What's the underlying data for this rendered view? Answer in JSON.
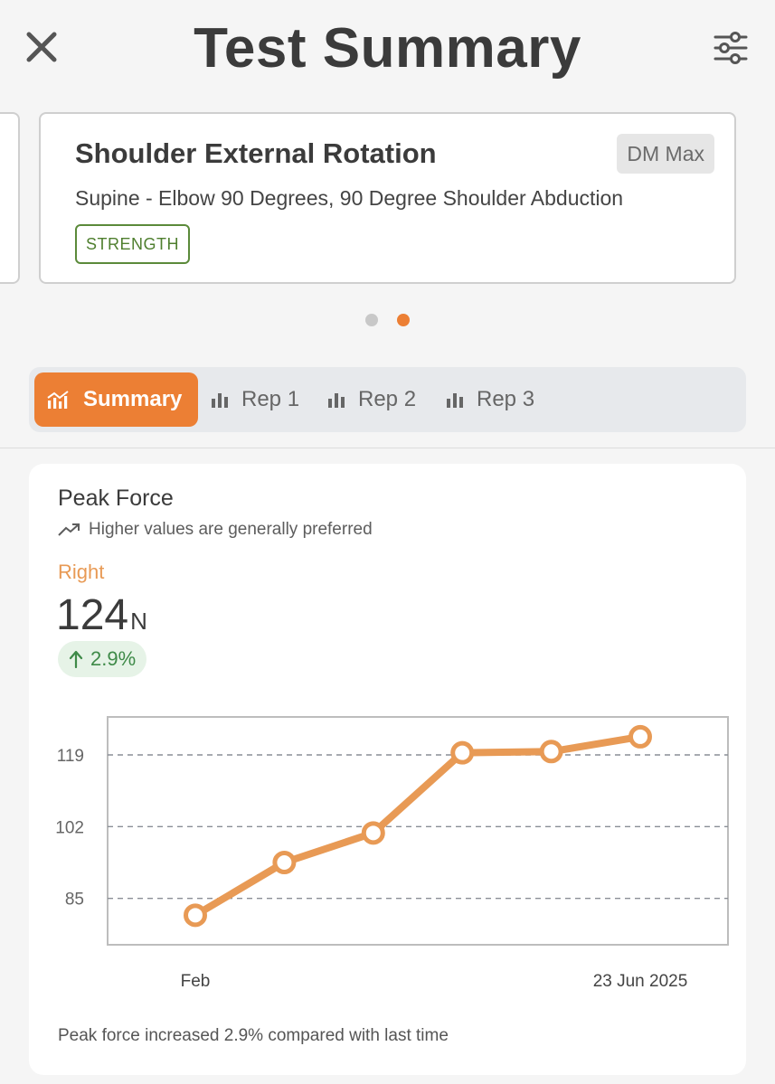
{
  "header": {
    "title": "Test Summary",
    "close_icon": "close-icon",
    "filter_icon": "sliders-icon"
  },
  "test_card": {
    "name": "Shoulder External Rotation",
    "device": "DM Max",
    "description": "Supine - Elbow 90 Degrees, 90 Degree Shoulder Abduction",
    "category": "STRENGTH",
    "category_color": "#5b8a3a"
  },
  "pager": {
    "count": 2,
    "active": 2,
    "active_color": "#ec7f34"
  },
  "tabs": [
    {
      "label": "Summary",
      "icon": "chart-icon",
      "active": true
    },
    {
      "label": "Rep 1",
      "icon": "bar-chart-icon",
      "active": false
    },
    {
      "label": "Rep 2",
      "icon": "bar-chart-icon",
      "active": false
    },
    {
      "label": "Rep 3",
      "icon": "bar-chart-icon",
      "active": false
    }
  ],
  "metric": {
    "title": "Peak Force",
    "preference_text": "Higher values are generally preferred",
    "side_label": "Right",
    "value": "124",
    "unit": "N",
    "change": "2.9%",
    "change_direction": "up",
    "footer": "Peak force increased 2.9% compared with last time",
    "accent_color": "#e89a55",
    "change_color": "#3e8a48"
  },
  "chart_data": {
    "type": "line",
    "title": "",
    "xlabel": "",
    "ylabel": "",
    "x_tick_labels": [
      "Feb",
      "23 Jun 2025"
    ],
    "y_ticks": [
      85,
      102,
      119
    ],
    "ylim": [
      74,
      128
    ],
    "grid": "horizontal dashed",
    "series": [
      {
        "values": [
          81,
          93.5,
          100.5,
          119.5,
          119.8,
          123.3
        ],
        "color": "#e89a55"
      }
    ]
  }
}
